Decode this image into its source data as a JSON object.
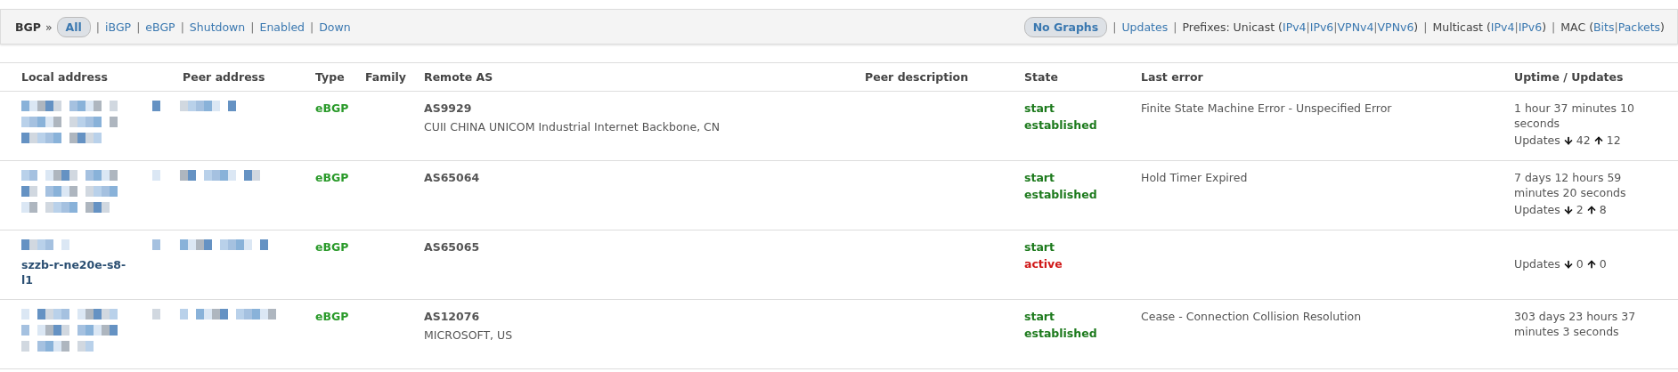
{
  "toolbar": {
    "title": "BGP",
    "arrow": "»",
    "separator": "|",
    "filters": [
      {
        "label": "All",
        "selected": true
      },
      {
        "label": "iBGP",
        "selected": false
      },
      {
        "label": "eBGP",
        "selected": false
      },
      {
        "label": "Shutdown",
        "selected": false
      },
      {
        "label": "Enabled",
        "selected": false
      },
      {
        "label": "Down",
        "selected": false
      }
    ],
    "right": [
      {
        "kind": "toggle",
        "label": "No Graphs",
        "selected": true
      },
      {
        "kind": "link",
        "label": "Updates"
      },
      {
        "kind": "group",
        "label": "Prefixes: Unicast (",
        "links": [
          "IPv4",
          "IPv6",
          "VPNv4",
          "VPNv6"
        ],
        "close": ")"
      },
      {
        "kind": "group",
        "label": "Multicast (",
        "links": [
          "IPv4",
          "IPv6"
        ],
        "close": ")"
      },
      {
        "kind": "group",
        "label": "MAC (",
        "links": [
          "Bits",
          "Packets"
        ],
        "close": ")"
      }
    ]
  },
  "table": {
    "columns": [
      "Local address",
      "Peer address",
      "Type",
      "Family",
      "Remote AS",
      "Peer description",
      "State",
      "Last error",
      "Uptime / Updates"
    ],
    "rows": [
      {
        "type": "eBGP",
        "remote_as": "AS9929",
        "as_name": "CUII CHINA UNICOM Industrial Internet Backbone, CN",
        "state": [
          {
            "text": "start",
            "kind": "ok"
          },
          {
            "text": "established",
            "kind": "ok"
          }
        ],
        "last_error": "Finite State Machine Error - Unspecified Error",
        "uptime": "1 hour 37 minutes 10 seconds",
        "updates": {
          "label": "Updates",
          "down": "42",
          "up": "12"
        }
      },
      {
        "type": "eBGP",
        "remote_as": "AS65064",
        "state": [
          {
            "text": "start",
            "kind": "ok"
          },
          {
            "text": "established",
            "kind": "ok"
          }
        ],
        "last_error": "Hold Timer Expired",
        "uptime": "7 days 12 hours 59 minutes 20 seconds",
        "updates": {
          "label": "Updates",
          "down": "2",
          "up": "8"
        }
      },
      {
        "local_hostname": "szzb-r-ne20e-s8-l1",
        "type": "eBGP",
        "remote_as": "AS65065",
        "state": [
          {
            "text": "start",
            "kind": "ok"
          },
          {
            "text": "active",
            "kind": "bad"
          }
        ],
        "updates": {
          "label": "Updates",
          "down": "0",
          "up": "0"
        }
      },
      {
        "type": "eBGP",
        "remote_as": "AS12076",
        "as_name": "MICROSOFT, US",
        "state": [
          {
            "text": "start",
            "kind": "ok"
          },
          {
            "text": "established",
            "kind": "ok"
          }
        ],
        "last_error": "Cease - Connection Collision Resolution",
        "uptime": "303 days 23 hours 37 minutes 3 seconds"
      }
    ]
  }
}
